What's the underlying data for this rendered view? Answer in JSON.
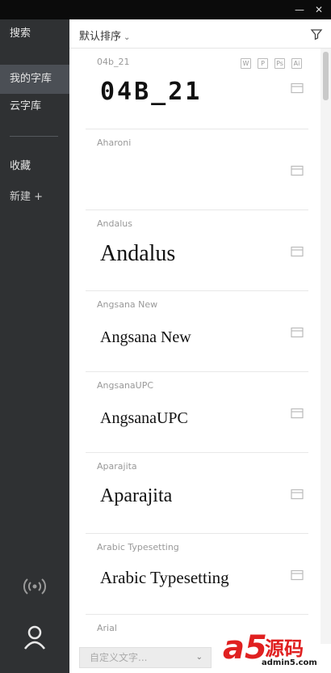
{
  "window": {
    "minimize": "—",
    "close": "✕"
  },
  "sidebar": {
    "search": "搜索",
    "my_library": "我的字库",
    "cloud_library": "云字库",
    "favorites": "收藏",
    "new": "新建 +"
  },
  "toolbar": {
    "sort_label": "默认排序",
    "sort_chevron": "⌄"
  },
  "badges": [
    "W",
    "P",
    "Ps",
    "Ai"
  ],
  "fonts": [
    {
      "name": "04b_21",
      "preview": "04B_21"
    },
    {
      "name": "Aharoni",
      "preview": ""
    },
    {
      "name": "Andalus",
      "preview": "Andalus"
    },
    {
      "name": "Angsana New",
      "preview": "Angsana New"
    },
    {
      "name": "AngsanaUPC",
      "preview": "AngsanaUPC"
    },
    {
      "name": "Aparajita",
      "preview": "Aparajita"
    },
    {
      "name": "Arabic Typesetting",
      "preview": "Arabic Typesetting"
    },
    {
      "name": "Arial",
      "preview": ""
    }
  ],
  "bottom": {
    "custom_text_placeholder": "自定义文字...",
    "chevron": "⌄"
  },
  "watermark": {
    "logo": "a5",
    "cn": "源码",
    "site": "admin5.com"
  }
}
